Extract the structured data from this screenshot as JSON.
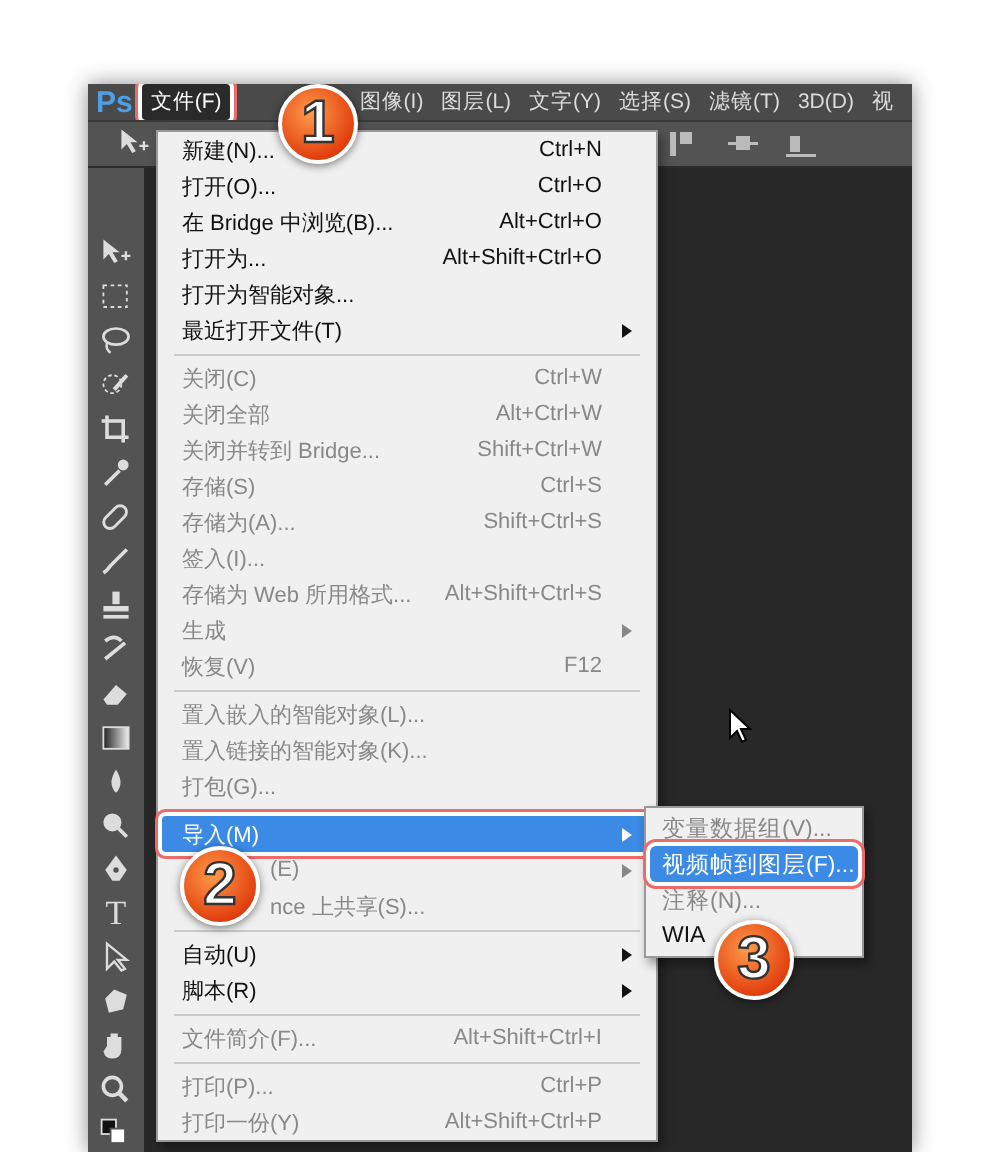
{
  "menubar": {
    "logo": "Ps",
    "items": [
      {
        "label": "文件(F)",
        "selected": true,
        "annotated": true
      },
      {
        "label": "图像(I)",
        "selected": false,
        "annotated": false
      },
      {
        "label": "图层(L)",
        "selected": false,
        "annotated": false
      },
      {
        "label": "文字(Y)",
        "selected": false,
        "annotated": false
      },
      {
        "label": "选择(S)",
        "selected": false,
        "annotated": false
      },
      {
        "label": "滤镜(T)",
        "selected": false,
        "annotated": false
      },
      {
        "label": "3D(D)",
        "selected": false,
        "annotated": false
      },
      {
        "label": "视",
        "selected": false,
        "annotated": false
      }
    ]
  },
  "toolbar": {
    "type_tool_glyph": "T"
  },
  "file_menu": {
    "items": [
      {
        "kind": "item",
        "label": "新建(N)...",
        "shortcut": "Ctrl+N",
        "enabled": true,
        "submenu": false,
        "selected": false,
        "annotated": false,
        "covered": false
      },
      {
        "kind": "item",
        "label": "打开(O)...",
        "shortcut": "Ctrl+O",
        "enabled": true,
        "submenu": false,
        "selected": false,
        "annotated": false,
        "covered": false
      },
      {
        "kind": "item",
        "label": "在 Bridge 中浏览(B)...",
        "shortcut": "Alt+Ctrl+O",
        "enabled": true,
        "submenu": false,
        "selected": false,
        "annotated": false,
        "covered": false
      },
      {
        "kind": "item",
        "label": "打开为...",
        "shortcut": "Alt+Shift+Ctrl+O",
        "enabled": true,
        "submenu": false,
        "selected": false,
        "annotated": false,
        "covered": false
      },
      {
        "kind": "item",
        "label": "打开为智能对象...",
        "enabled": true,
        "submenu": false,
        "selected": false,
        "annotated": false,
        "covered": false
      },
      {
        "kind": "item",
        "label": "最近打开文件(T)",
        "enabled": true,
        "submenu": true,
        "selected": false,
        "annotated": false,
        "covered": false
      },
      {
        "kind": "separator"
      },
      {
        "kind": "item",
        "label": "关闭(C)",
        "shortcut": "Ctrl+W",
        "enabled": false,
        "submenu": false,
        "selected": false,
        "annotated": false,
        "covered": false
      },
      {
        "kind": "item",
        "label": "关闭全部",
        "shortcut": "Alt+Ctrl+W",
        "enabled": false,
        "submenu": false,
        "selected": false,
        "annotated": false,
        "covered": false
      },
      {
        "kind": "item",
        "label": "关闭并转到 Bridge...",
        "shortcut": "Shift+Ctrl+W",
        "enabled": false,
        "submenu": false,
        "selected": false,
        "annotated": false,
        "covered": false
      },
      {
        "kind": "item",
        "label": "存储(S)",
        "shortcut": "Ctrl+S",
        "enabled": false,
        "submenu": false,
        "selected": false,
        "annotated": false,
        "covered": false
      },
      {
        "kind": "item",
        "label": "存储为(A)...",
        "shortcut": "Shift+Ctrl+S",
        "enabled": false,
        "submenu": false,
        "selected": false,
        "annotated": false,
        "covered": false
      },
      {
        "kind": "item",
        "label": "签入(I)...",
        "enabled": false,
        "submenu": false,
        "selected": false,
        "annotated": false,
        "covered": false
      },
      {
        "kind": "item",
        "label": "存储为 Web 所用格式...",
        "shortcut": "Alt+Shift+Ctrl+S",
        "enabled": false,
        "submenu": false,
        "selected": false,
        "annotated": false,
        "covered": false
      },
      {
        "kind": "item",
        "label": "生成",
        "enabled": false,
        "submenu": true,
        "selected": false,
        "annotated": false,
        "covered": false
      },
      {
        "kind": "item",
        "label": "恢复(V)",
        "shortcut": "F12",
        "enabled": false,
        "submenu": false,
        "selected": false,
        "annotated": false,
        "covered": false
      },
      {
        "kind": "separator"
      },
      {
        "kind": "item",
        "label": "置入嵌入的智能对象(L)...",
        "enabled": false,
        "submenu": false,
        "selected": false,
        "annotated": false,
        "covered": false
      },
      {
        "kind": "item",
        "label": "置入链接的智能对象(K)...",
        "enabled": false,
        "submenu": false,
        "selected": false,
        "annotated": false,
        "covered": false
      },
      {
        "kind": "item",
        "label": "打包(G)...",
        "enabled": false,
        "submenu": false,
        "selected": false,
        "annotated": false,
        "covered": false
      },
      {
        "kind": "separator"
      },
      {
        "kind": "item",
        "label": "导入(M)",
        "enabled": true,
        "submenu": true,
        "selected": true,
        "annotated": true,
        "covered": false
      },
      {
        "kind": "item",
        "label": "(E)",
        "enabled": false,
        "submenu": true,
        "selected": false,
        "annotated": false,
        "covered": true
      },
      {
        "kind": "item",
        "label": "nce 上共享(S)...",
        "enabled": false,
        "submenu": false,
        "selected": false,
        "annotated": false,
        "covered": true
      },
      {
        "kind": "separator"
      },
      {
        "kind": "item",
        "label": "自动(U)",
        "enabled": true,
        "submenu": true,
        "selected": false,
        "annotated": false,
        "covered": false
      },
      {
        "kind": "item",
        "label": "脚本(R)",
        "enabled": true,
        "submenu": true,
        "selected": false,
        "annotated": false,
        "covered": false
      },
      {
        "kind": "separator"
      },
      {
        "kind": "item",
        "label": "文件简介(F)...",
        "shortcut": "Alt+Shift+Ctrl+I",
        "enabled": false,
        "submenu": false,
        "selected": false,
        "annotated": false,
        "covered": false
      },
      {
        "kind": "separator"
      },
      {
        "kind": "item",
        "label": "打印(P)...",
        "shortcut": "Ctrl+P",
        "enabled": false,
        "submenu": false,
        "selected": false,
        "annotated": false,
        "covered": false
      },
      {
        "kind": "item",
        "label": "打印一份(Y)",
        "shortcut": "Alt+Shift+Ctrl+P",
        "enabled": false,
        "submenu": false,
        "selected": false,
        "annotated": false,
        "covered": false
      }
    ]
  },
  "import_submenu": {
    "items": [
      {
        "label": "变量数据组(V)...",
        "enabled": false,
        "selected": false,
        "annotated": false
      },
      {
        "label": "视频帧到图层(F)...",
        "enabled": true,
        "selected": true,
        "annotated": true
      },
      {
        "label": "注释(N)...",
        "enabled": false,
        "selected": false,
        "annotated": false
      },
      {
        "label": "WIA",
        "enabled": true,
        "selected": false,
        "annotated": false
      }
    ]
  },
  "step_markers": [
    {
      "number": "1"
    },
    {
      "number": "2"
    },
    {
      "number": "3"
    }
  ]
}
